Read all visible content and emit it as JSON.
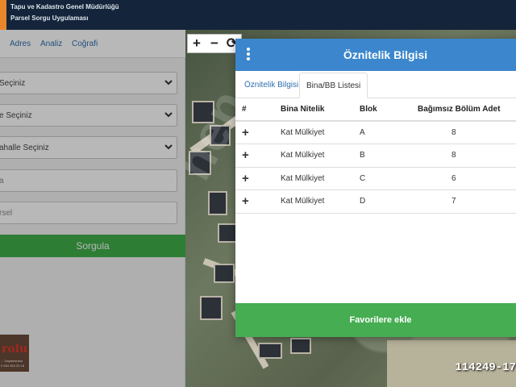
{
  "header": {
    "line1": "Tapu ve Kadastro Genel Müdürlüğü",
    "line2": "Parsel Sorgu Uygulaması"
  },
  "left_panel": {
    "tabs": [
      "Adres",
      "Analiz",
      "Coğrafi"
    ],
    "fields": [
      {
        "value": "Seçiniz",
        "type": "select"
      },
      {
        "value": "e Seçiniz",
        "type": "select"
      },
      {
        "value": "ahalle Seçiniz",
        "type": "select"
      },
      {
        "placeholder": "a",
        "type": "input"
      },
      {
        "placeholder": "rsel",
        "type": "input"
      }
    ],
    "button": "Sorgula"
  },
  "logo": {
    "text": "rolu",
    "sub1": "... Gayrimenkul",
    "sub2": "0 534 353 23 18"
  },
  "map_tools": [
    "+",
    "−",
    "⟳"
  ],
  "modal": {
    "title": "Öznitelik Bilgisi",
    "tabs": [
      {
        "label": "Öznitelik Bilgisi",
        "active": false
      },
      {
        "label": "Bina/BB Listesi",
        "active": true
      }
    ],
    "table": {
      "headers": [
        "#",
        "Bina Nitelik",
        "Blok",
        "Bağımsız Bölüm Adet"
      ],
      "rows": [
        {
          "expand": "+",
          "nitelik": "Kat Mülkiyet",
          "blok": "A",
          "adet": "8"
        },
        {
          "expand": "+",
          "nitelik": "Kat Mülkiyet",
          "blok": "B",
          "adet": "8"
        },
        {
          "expand": "+",
          "nitelik": "Kat Mülkiyet",
          "blok": "C",
          "adet": "6"
        },
        {
          "expand": "+",
          "nitelik": "Kat Mülkiyet",
          "blok": "D",
          "adet": "7"
        }
      ]
    },
    "favorite_button": "Favorilere ekle"
  },
  "watermark": "hep",
  "listing_id": "114249-17",
  "colors": {
    "header_bg": "#14243a",
    "accent": "#e8862a",
    "modal_header": "#3b86cc",
    "green_button": "#46ad52",
    "link": "#2f6fb0"
  }
}
